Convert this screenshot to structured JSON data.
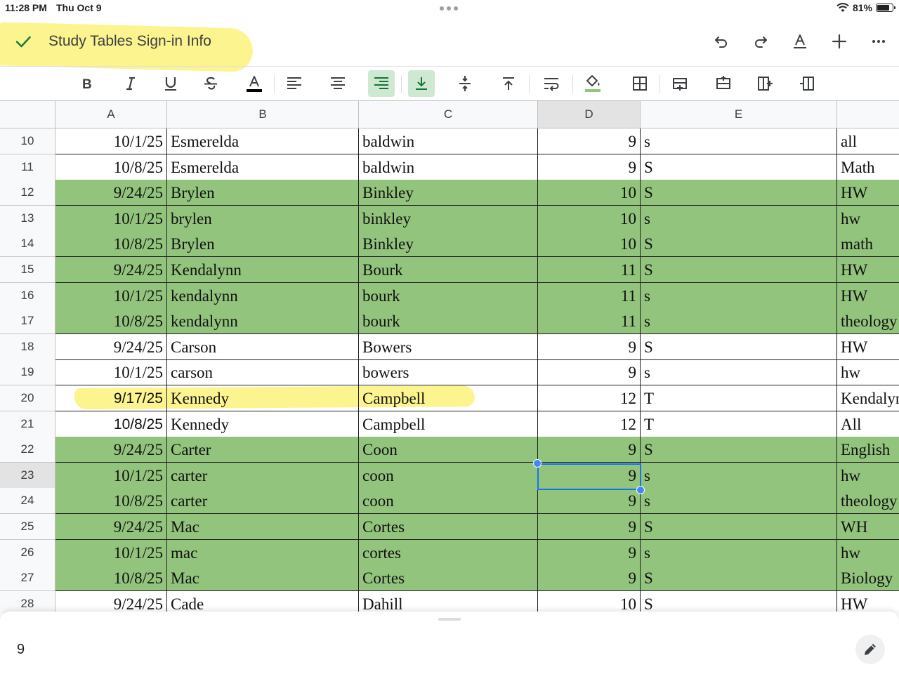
{
  "status_bar": {
    "time": "11:28 PM",
    "date": "Thu Oct 9",
    "battery": "81%",
    "battery_level": 0.81
  },
  "document": {
    "title": "Study Tables Sign-in Info"
  },
  "columns": [
    "A",
    "B",
    "C",
    "D",
    "E"
  ],
  "selected_cell": {
    "column": "D",
    "row": "23",
    "value": "9"
  },
  "rows": [
    {
      "num": "10",
      "a": "10/1/25",
      "b": "Esmerelda",
      "c": "baldwin",
      "d": "9",
      "e": "s",
      "f": "all",
      "green": false
    },
    {
      "num": "11",
      "a": "10/8/25",
      "b": "Esmerelda",
      "c": "baldwin",
      "d": "9",
      "e": "S",
      "f": "Math",
      "green": false
    },
    {
      "num": "12",
      "a": "9/24/25",
      "b": "Brylen",
      "c": "Binkley",
      "d": "10",
      "e": "S",
      "f": "HW",
      "green": true
    },
    {
      "num": "13",
      "a": "10/1/25",
      "b": "brylen",
      "c": "binkley",
      "d": "10",
      "e": "s",
      "f": "hw",
      "green": true
    },
    {
      "num": "14",
      "a": "10/8/25",
      "b": "Brylen",
      "c": "Binkley",
      "d": "10",
      "e": "S",
      "f": "math",
      "green": true
    },
    {
      "num": "15",
      "a": "9/24/25",
      "b": "Kendalynn",
      "c": "Bourk",
      "d": "11",
      "e": "S",
      "f": "HW",
      "green": true
    },
    {
      "num": "16",
      "a": "10/1/25",
      "b": "kendalynn",
      "c": "bourk",
      "d": "11",
      "e": "s",
      "f": "HW",
      "green": true
    },
    {
      "num": "17",
      "a": "10/8/25",
      "b": "kendalynn",
      "c": "bourk",
      "d": "11",
      "e": "s",
      "f": "theology",
      "green": true
    },
    {
      "num": "18",
      "a": "9/24/25",
      "b": "Carson",
      "c": "Bowers",
      "d": "9",
      "e": "S",
      "f": "HW",
      "green": false
    },
    {
      "num": "19",
      "a": "10/1/25",
      "b": "carson",
      "c": "bowers",
      "d": "9",
      "e": "s",
      "f": "hw",
      "green": false
    },
    {
      "num": "20",
      "a": "9/17/25",
      "b": "Kennedy",
      "c": "Campbell",
      "d": "12",
      "e": "T",
      "f": "Kendalynn",
      "green": false
    },
    {
      "num": "21",
      "a": "10/8/25",
      "b": "Kennedy",
      "c": "Campbell",
      "d": "12",
      "e": "T",
      "f": "All",
      "green": false
    },
    {
      "num": "22",
      "a": "9/24/25",
      "b": "Carter",
      "c": "Coon",
      "d": "9",
      "e": "S",
      "f": "English",
      "green": true
    },
    {
      "num": "23",
      "a": "10/1/25",
      "b": "carter",
      "c": "coon",
      "d": "9",
      "e": "s",
      "f": "hw",
      "green": true
    },
    {
      "num": "24",
      "a": "10/8/25",
      "b": "carter",
      "c": "coon",
      "d": "9",
      "e": "s",
      "f": "theology",
      "green": true
    },
    {
      "num": "25",
      "a": "9/24/25",
      "b": "Mac",
      "c": "Cortes",
      "d": "9",
      "e": "S",
      "f": "WH",
      "green": true
    },
    {
      "num": "26",
      "a": "10/1/25",
      "b": "mac",
      "c": "cortes",
      "d": "9",
      "e": "s",
      "f": "hw",
      "green": true
    },
    {
      "num": "27",
      "a": "10/8/25",
      "b": "Mac",
      "c": "Cortes",
      "d": "9",
      "e": "S",
      "f": "Biology",
      "green": true
    },
    {
      "num": "28",
      "a": "9/24/25",
      "b": "Cade",
      "c": "Dahill",
      "d": "10",
      "e": "S",
      "f": "HW",
      "green": false
    }
  ],
  "formula_bar": {
    "value": "9"
  }
}
